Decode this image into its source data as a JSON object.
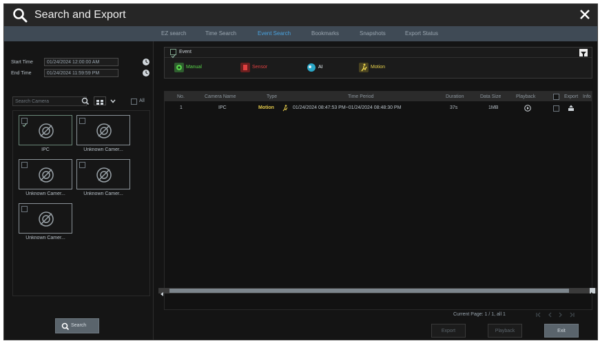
{
  "window": {
    "title": "Search and Export"
  },
  "tabs": [
    "EZ search",
    "Time Search",
    "Event Search",
    "Bookmarks",
    "Snapshots",
    "Export Status"
  ],
  "active_tab": 2,
  "left": {
    "start_time_label": "Start Time",
    "start_time_value": "01/24/2024 12:00:00 AM",
    "end_time_label": "End Time",
    "end_time_value": "01/24/2024 11:59:59 PM",
    "search_camera_placeholder": "Search Camera",
    "all_label": "All",
    "cameras": [
      {
        "name": "IPC",
        "checked": true
      },
      {
        "name": "Unknown Camer...",
        "checked": false
      },
      {
        "name": "Unknown Camer...",
        "checked": false
      },
      {
        "name": "Unknown Camer...",
        "checked": false
      },
      {
        "name": "Unknown Camer...",
        "checked": false
      }
    ],
    "search_button": "Search"
  },
  "event_filter": {
    "label": "Event",
    "types": [
      {
        "label": "Manual",
        "color": "#58d24a",
        "icon": "manual-icon"
      },
      {
        "label": "Sensor",
        "color": "#e04040",
        "icon": "sensor-icon"
      },
      {
        "label": "AI",
        "color": "#e6eef2",
        "icon": "ai-icon"
      },
      {
        "label": "Motion",
        "color": "#e8d24c",
        "icon": "motion-icon"
      }
    ]
  },
  "table": {
    "columns": [
      "No.",
      "Camera Name",
      "Type",
      "Time Period",
      "Duration",
      "Data Size",
      "Playback",
      "Export",
      "Info"
    ],
    "rows": [
      {
        "no": "1",
        "camera": "IPC",
        "type": "Motion",
        "time_period": "01/24/2024 08:47:53 PM~01/24/2024 08:48:30 PM",
        "duration": "37s",
        "data_size": "1MB"
      }
    ]
  },
  "pager": {
    "text": "Current Page: 1 / 1, all 1"
  },
  "footer": {
    "export": "Export",
    "playback": "Playback",
    "exit": "Exit"
  }
}
